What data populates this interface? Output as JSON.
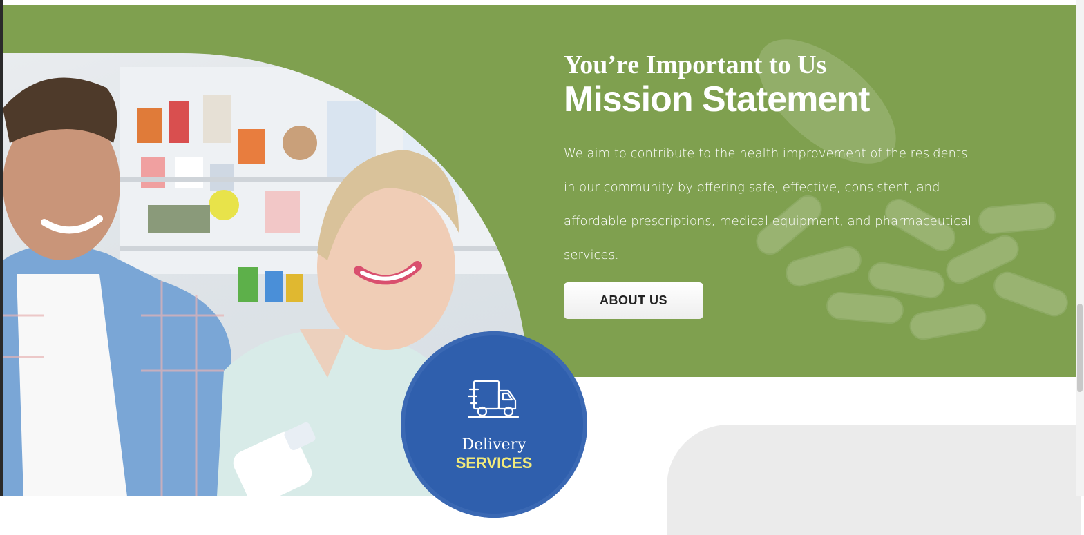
{
  "mission": {
    "subtitle": "You’re Important to Us",
    "title": "Mission Statement",
    "body": "We aim to contribute to the health improvement of the residents in our community by offering safe, effective, consistent, and affordable prescriptions, medical equipment, and pharmaceutical services.",
    "button_label": "ABOUT US"
  },
  "delivery": {
    "label": "Delivery",
    "highlight": "SERVICES",
    "icon": "delivery-truck-icon"
  },
  "photo": {
    "description_icon": "pharmacy-customers-photo"
  },
  "colors": {
    "green_band": "#7fa04f",
    "delivery_blue": "#2f5fad",
    "services_yellow": "#f2ea7a",
    "button_text": "#222222"
  }
}
